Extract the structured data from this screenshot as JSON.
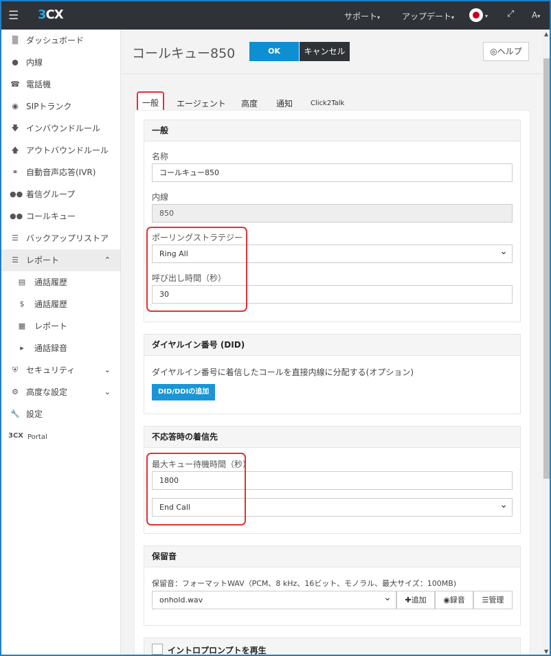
{
  "topbar": {
    "logo_prefix": "3",
    "logo_suffix": "CX",
    "support": "サポート",
    "updates": "アップデート",
    "user": "A"
  },
  "sidebar": {
    "items": [
      {
        "label": "ダッシュボード",
        "icon": "bar-chart-icon"
      },
      {
        "label": "内線",
        "icon": "user-icon"
      },
      {
        "label": "電話機",
        "icon": "phone-icon"
      },
      {
        "label": "SIPトランク",
        "icon": "globe-icon"
      },
      {
        "label": "インバウンドルール",
        "icon": "arrow-down-icon"
      },
      {
        "label": "アウトバウンドルール",
        "icon": "arrow-up-icon"
      },
      {
        "label": "自動音声応答(IVR)",
        "icon": "headset-icon"
      },
      {
        "label": "着信グループ",
        "icon": "group-icon"
      },
      {
        "label": "コールキュー",
        "icon": "users-icon"
      },
      {
        "label": "バックアップリストア",
        "icon": "database-icon"
      },
      {
        "label": "レポート",
        "icon": "list-icon"
      }
    ],
    "report_sub": [
      {
        "label": "通話履歴",
        "icon": "document-icon"
      },
      {
        "label": "通話履歴",
        "icon": "dollar-icon"
      },
      {
        "label": "レポート",
        "icon": "report-icon"
      },
      {
        "label": "通話録音",
        "icon": "speaker-icon"
      }
    ],
    "security": "セキュリティ",
    "advanced": "高度な設定",
    "settings": "設定",
    "portal_logo": "3CX",
    "portal": "Portal"
  },
  "header": {
    "title": "コールキュー850",
    "ok": "OK",
    "cancel": "キャンセル",
    "help": "ヘルプ"
  },
  "tabs": [
    "一般",
    "エージェント",
    "高度",
    "通知",
    "Click2Talk"
  ],
  "general": {
    "heading": "一般",
    "name_label": "名称",
    "name_value": "コールキュー850",
    "ext_label": "内線",
    "ext_value": "850",
    "strategy_label": "ポーリングストラテジー",
    "strategy_value": "Ring All",
    "ring_time_label": "呼び出し時間（秒）",
    "ring_time_value": "30"
  },
  "did": {
    "heading": "ダイヤルイン番号 (DID)",
    "desc": "ダイヤルイン番号に着信したコールを直接内線に分配する(オプション)",
    "add_button": "DID/DDIの追加"
  },
  "no_answer": {
    "heading": "不応答時の着信先",
    "max_wait_label": "最大キュー待機時間（秒）",
    "max_wait_value": "1800",
    "action_value": "End Call"
  },
  "moh": {
    "heading": "保留音",
    "desc": "保留音：フォーマットWAV（PCM、8 kHz、16ビット、モノラル、最大サイズ：100MB)",
    "file": "onhold.wav",
    "add": "追加",
    "record": "録音",
    "manage": "管理"
  },
  "intro": {
    "label": "イントロプロンプトを再生"
  }
}
